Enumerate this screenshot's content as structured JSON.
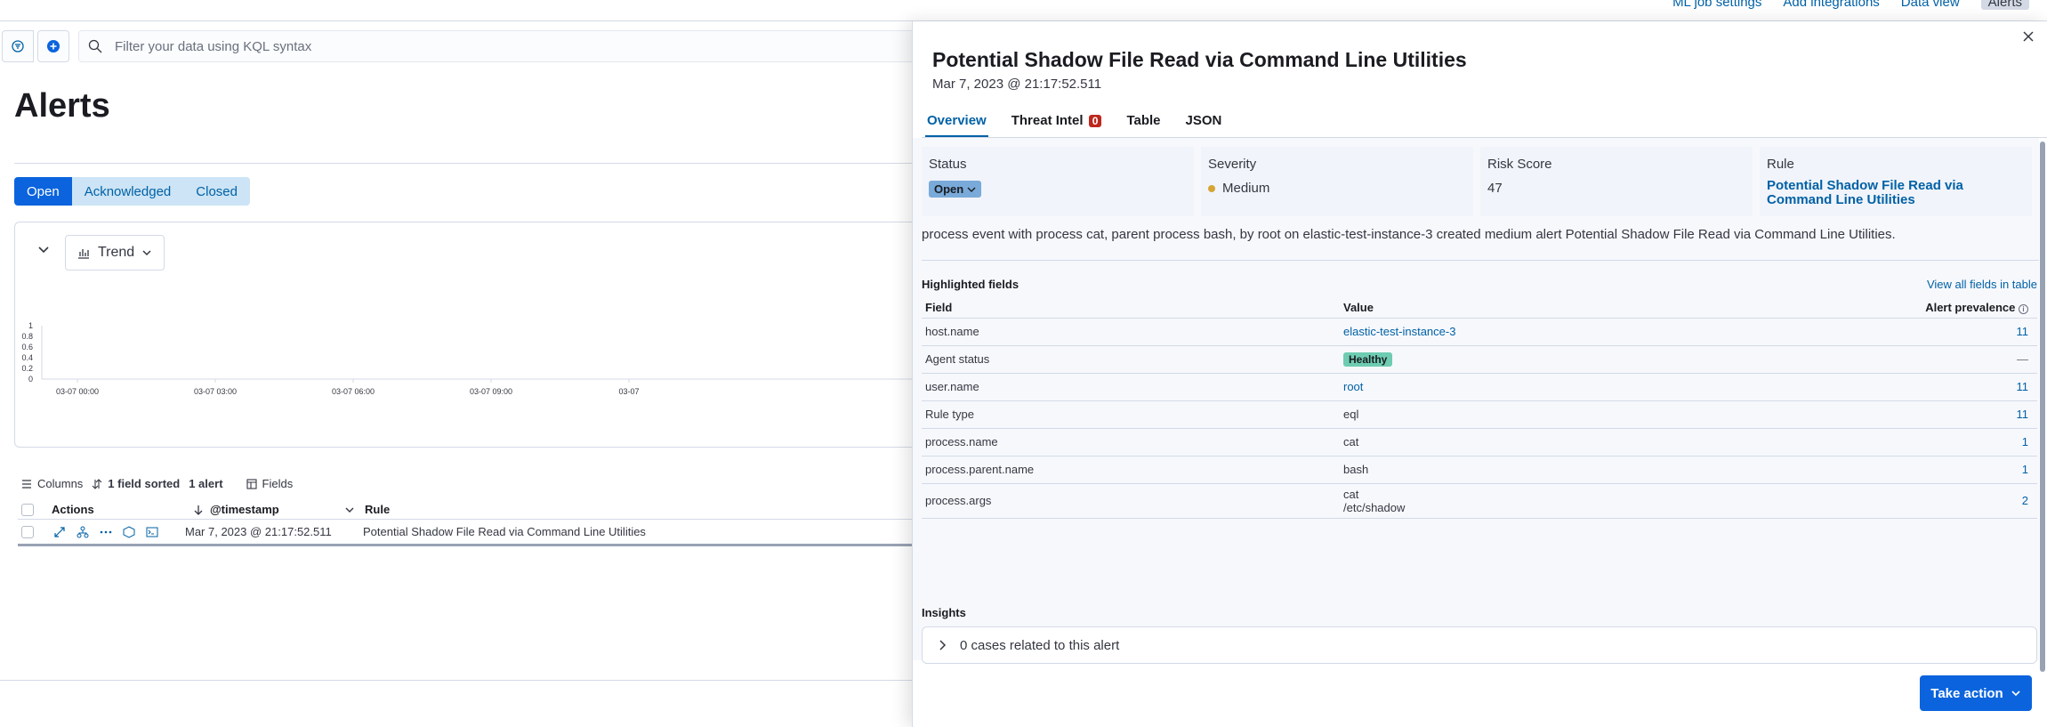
{
  "header": {
    "links": [
      "ML job settings",
      "Add integrations",
      "Data view"
    ],
    "dataview_badge": "Alerts"
  },
  "query": {
    "placeholder": "Filter your data using KQL syntax"
  },
  "page_title": "Alerts",
  "status_filter": {
    "options": [
      "Open",
      "Acknowledged",
      "Closed"
    ],
    "selected": "Open"
  },
  "trend": {
    "button_label": "Trend",
    "chart_data": {
      "type": "line",
      "x": [
        "03-07 00:00",
        "03-07 03:00",
        "03-07 06:00",
        "03-07 09:00",
        "03-07"
      ],
      "y_ticks": [
        "0",
        "0.2",
        "0.4",
        "0.6",
        "0.8",
        "1"
      ],
      "ylim": [
        0,
        1
      ],
      "series": []
    }
  },
  "table_toolbar": {
    "columns": "Columns",
    "sorted": "1 field sorted",
    "count": "1 alert",
    "fields": "Fields"
  },
  "table": {
    "columns": [
      "Actions",
      "@timestamp",
      "Rule"
    ],
    "rows": [
      {
        "timestamp": "Mar 7, 2023 @ 21:17:52.511",
        "rule": "Potential Shadow File Read via Command Line Utilities"
      }
    ]
  },
  "flyout": {
    "title": "Potential Shadow File Read via Command Line Utilities",
    "date": "Mar 7, 2023 @ 21:17:52.511",
    "tabs": [
      "Overview",
      "Threat Intel",
      "Table",
      "JSON"
    ],
    "threat_intel_count": "0",
    "cards": {
      "status_label": "Status",
      "status_value": "Open",
      "severity_label": "Severity",
      "severity_value": "Medium",
      "risk_label": "Risk Score",
      "risk_value": "47",
      "rule_label": "Rule",
      "rule_value": "Potential Shadow File Read via Command Line Utilities"
    },
    "reason": "process event with process cat, parent process bash, by root on elastic-test-instance-3 created medium alert Potential Shadow File Read via Command Line Utilities.",
    "highlighted": {
      "title": "Highlighted fields",
      "view_all": "View all fields in table",
      "headers": [
        "Field",
        "Value",
        "Alert prevalence"
      ],
      "rows": [
        {
          "field": "host.name",
          "value": "elastic-test-instance-3",
          "prevalence": "11"
        },
        {
          "field": "Agent status",
          "value": "Healthy",
          "prevalence": "—"
        },
        {
          "field": "user.name",
          "value": "root",
          "prevalence": "11"
        },
        {
          "field": "Rule type",
          "value": "eql",
          "prevalence": "11"
        },
        {
          "field": "process.name",
          "value": "cat",
          "prevalence": "1"
        },
        {
          "field": "process.parent.name",
          "value": "bash",
          "prevalence": "1"
        },
        {
          "field": "process.args",
          "value": "cat",
          "value2": "/etc/shadow",
          "prevalence": "2"
        }
      ]
    },
    "insights": {
      "title": "Insights",
      "cases": "0 cases related to this alert"
    },
    "take_action": "Take action"
  }
}
